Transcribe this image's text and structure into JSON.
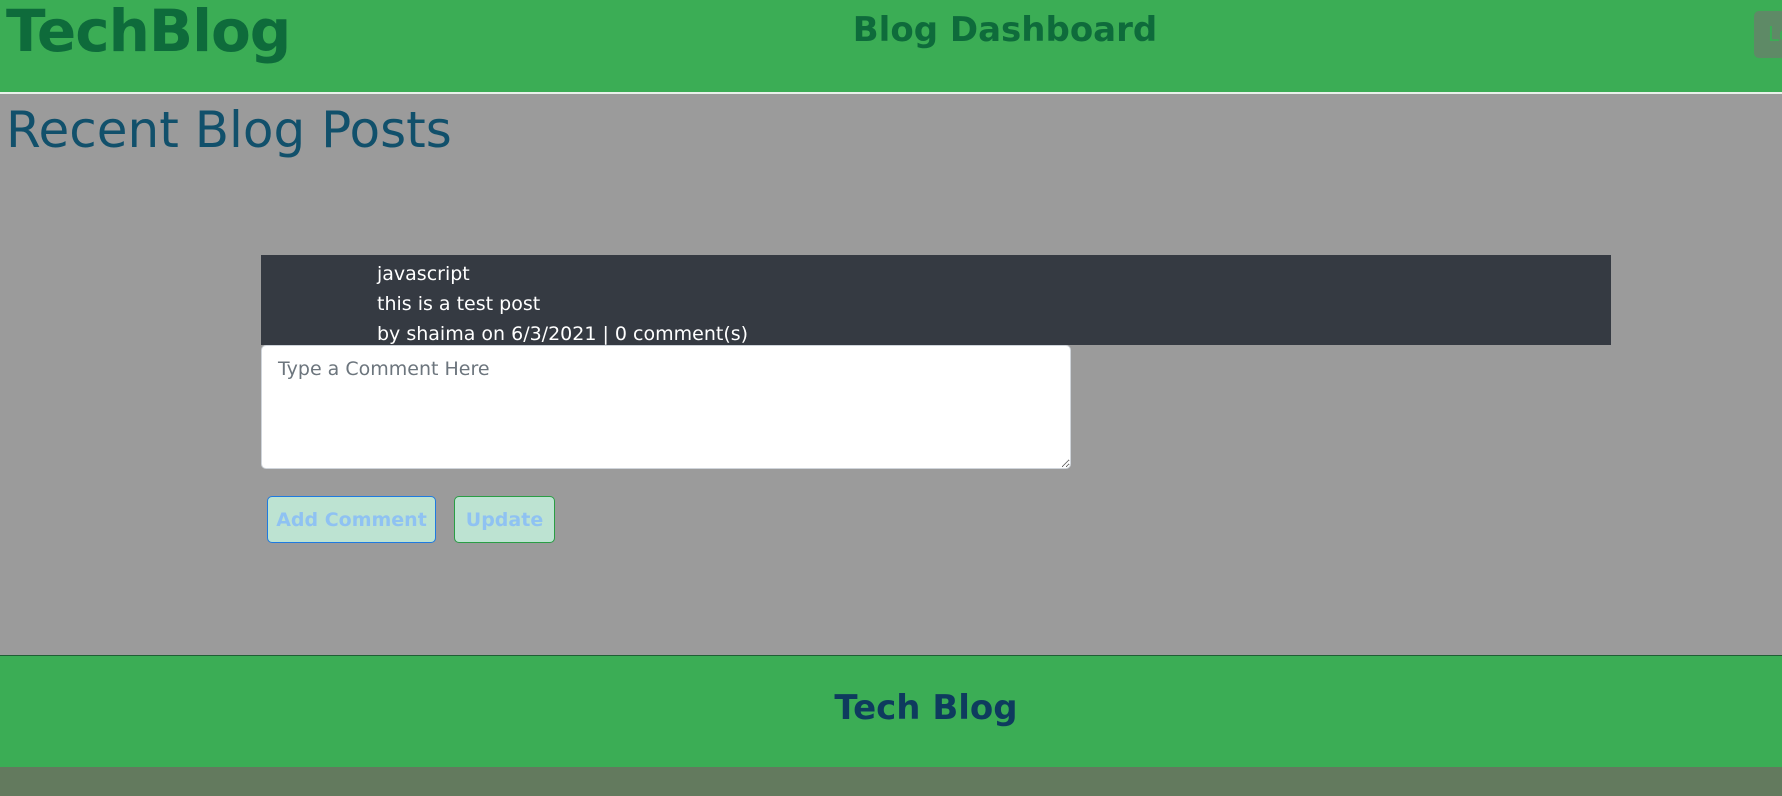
{
  "header": {
    "logo": "TechBlog",
    "title": "Blog Dashboard",
    "logout_label": "Logout"
  },
  "main": {
    "heading": "Recent Blog Posts",
    "post": {
      "title": "javascript",
      "body": "this is a test post",
      "meta": "by shaima on 6/3/2021 | 0 comment(s)"
    },
    "comment": {
      "value": "",
      "placeholder": "Type a Comment Here"
    },
    "buttons": {
      "add_comment": "Add Comment",
      "update": "Update"
    }
  },
  "footer": {
    "title": "Tech Blog"
  },
  "colors": {
    "header_bg": "#3bad55",
    "page_bg": "#9b9b9b",
    "post_bg": "#353a42",
    "heading": "#11506b",
    "logo": "#0e6b3b"
  }
}
